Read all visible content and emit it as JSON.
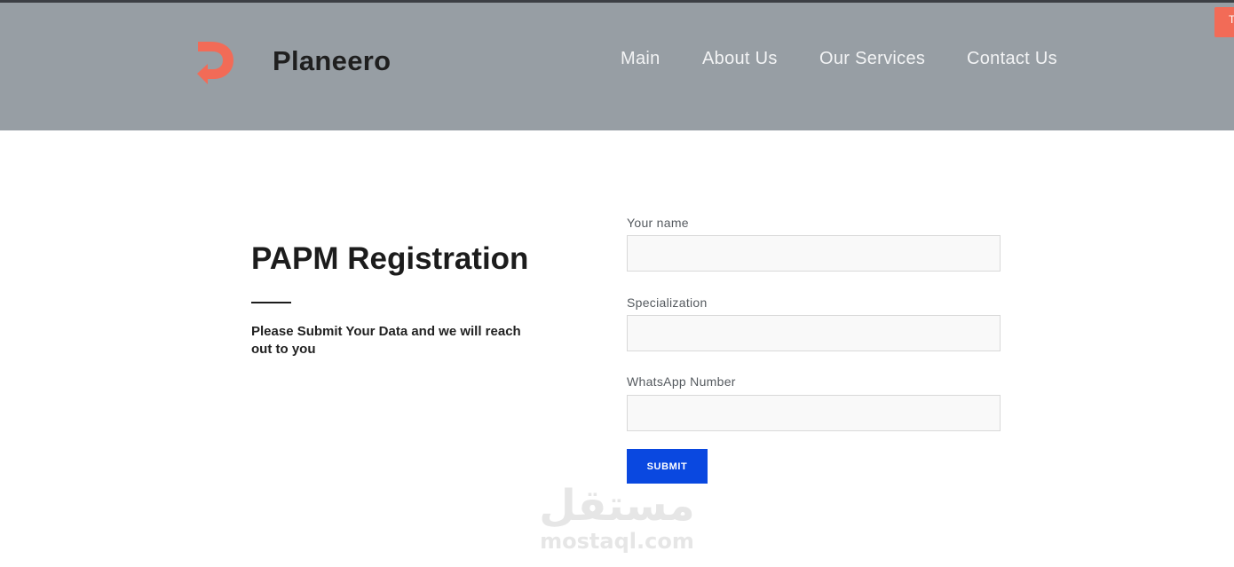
{
  "header": {
    "brand_name": "Planeero",
    "logo_icon": "planeero-logo-icon",
    "nav": [
      "Main",
      "About Us",
      "Our Services",
      "Contact Us"
    ],
    "corner_tab_glyph": "T",
    "background_color": "#979ea4",
    "accent_color": "#f26b57"
  },
  "intro": {
    "title": "PAPM Registration",
    "subtitle": "Please Submit Your Data and we will reach out to you"
  },
  "form": {
    "fields": [
      {
        "label": "Your name",
        "value": "",
        "placeholder": ""
      },
      {
        "label": "Specialization",
        "value": "",
        "placeholder": ""
      },
      {
        "label": "WhatsApp Number",
        "value": "",
        "placeholder": ""
      }
    ],
    "submit_label": "SUBMIT",
    "submit_color": "#0a48e0"
  },
  "watermark": {
    "arabic": "مستقل",
    "latin": "mostaql.com"
  }
}
